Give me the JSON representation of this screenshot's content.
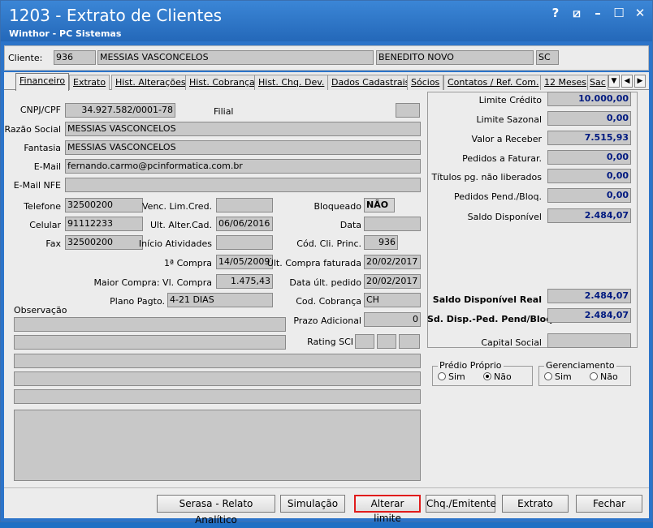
{
  "window": {
    "title": "1203 - Extrato de Clientes",
    "subtitle": "Winthor - PC Sistemas",
    "controls": [
      "?",
      "⧄",
      "–",
      "☐",
      "✕"
    ]
  },
  "client": {
    "label": "Cliente:",
    "code": "936",
    "name": "MESSIAS VASCONCELOS",
    "city": "BENEDITO NOVO",
    "state": "SC"
  },
  "tabs": [
    "Financeiro",
    "Extrato",
    "Hist. Alterações",
    "Hist. Cobrança",
    "Hist. Chq. Dev.",
    "Dados Cadastrais",
    "Sócios",
    "Contatos / Ref. Com.",
    "12 Meses",
    "Sac"
  ],
  "form": {
    "cnpj_label": "CNPJ/CPF",
    "cnpj": "34.927.582/0001-78",
    "filial_label": "Filial",
    "filial": "",
    "razao_label": "Razão Social",
    "razao": "MESSIAS VASCONCELOS",
    "fantasia_label": "Fantasia",
    "fantasia": "MESSIAS VASCONCELOS",
    "email_label": "E-Mail",
    "email": "fernando.carmo@pcinformatica.com.br",
    "email_nfe_label": "E-Mail NFE",
    "email_nfe": "",
    "telefone_label": "Telefone",
    "telefone": "32500200",
    "celular_label": "Celular",
    "celular": "91112233",
    "fax_label": "Fax",
    "fax": "32500200",
    "venc_label": "Venc. Lim.Cred.",
    "venc": "",
    "ult_alter_label": "Ult. Alter.Cad.",
    "ult_alter": "06/06/2016",
    "inicio_label": "Início Atividades",
    "inicio": "",
    "bloqueado_label": "Bloqueado",
    "bloqueado": "NÃO",
    "data_label": "Data",
    "data": "",
    "cod_cli_label": "Cód. Cli. Princ.",
    "cod_cli": "936",
    "primeira_compra_label": "1ª Compra",
    "primeira_compra": "14/05/2009",
    "ult_compra_label": "Últ. Compra faturada",
    "ult_compra": "20/02/2017",
    "maior_compra_label": "Maior Compra: Vl. Compra",
    "maior_compra": "1.475,43",
    "data_ult_pedido_label": "Data últ. pedido",
    "data_ult_pedido": "20/02/2017",
    "plano_label": "Plano Pagto.",
    "plano": "4-21 DIAS",
    "cod_cobranca_label": "Cod. Cobrança",
    "cod_cobranca": "CH",
    "prazo_label": "Prazo Adicional",
    "prazo": "0",
    "rating_label": "Rating SCI",
    "observacao_label": "Observação"
  },
  "limits": {
    "limite_credito_label": "Limite Crédito",
    "limite_credito": "10.000,00",
    "limite_sazonal_label": "Limite Sazonal",
    "limite_sazonal": "0,00",
    "valor_receber_label": "Valor a Receber",
    "valor_receber": "7.515,93",
    "pedidos_faturar_label": "Pedidos a Faturar.",
    "pedidos_faturar": "0,00",
    "titulos_label": "Títulos pg. não liberados",
    "titulos": "0,00",
    "pedidos_pend_label": "Pedidos Pend./Bloq.",
    "pedidos_pend": "0,00",
    "saldo_disp_label": "Saldo Disponível",
    "saldo_disp": "2.484,07",
    "saldo_real_label": "Saldo Disponível Real",
    "saldo_real": "2.484,07",
    "sd_disp_ped_label": "Sd. Disp.-Ped. Pend/Bloq.",
    "sd_disp_ped": "2.484,07",
    "capital_label": "Capital Social",
    "capital": ""
  },
  "predio": {
    "title": "Prédio Próprio",
    "sim": "Sim",
    "nao": "Não",
    "selected": "Não"
  },
  "gerenciamento": {
    "title": "Gerenciamento",
    "sim": "Sim",
    "nao": "Não",
    "selected": ""
  },
  "buttons": {
    "serasa": "Serasa - Relato Analítico",
    "simulacao": "Simulação",
    "alterar": "Alterar limite",
    "chq": "Chq./Emitente",
    "extrato": "Extrato",
    "fechar": "Fechar"
  }
}
